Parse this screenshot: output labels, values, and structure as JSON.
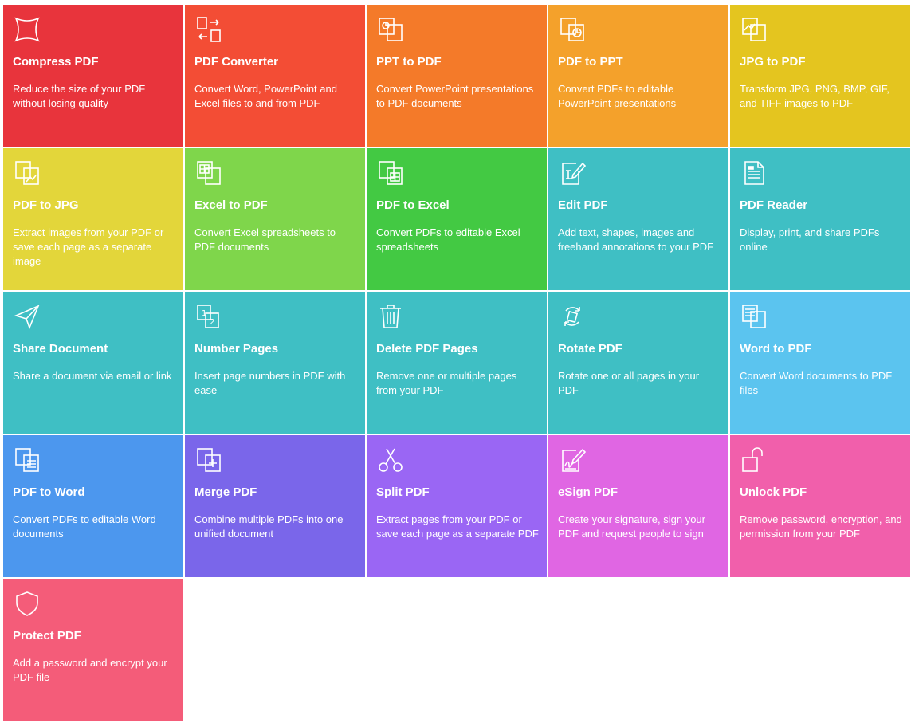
{
  "tools": [
    {
      "title": "Compress PDF",
      "desc": "Reduce the size of your PDF without losing quality",
      "icon": "compress-icon",
      "color": "#e8343c"
    },
    {
      "title": "PDF Converter",
      "desc": "Convert Word, PowerPoint and Excel files to and from PDF",
      "icon": "convert-arrows-icon",
      "color": "#f34d35"
    },
    {
      "title": "PPT to PDF",
      "desc": "Convert PowerPoint presentations to PDF documents",
      "icon": "ppt-document-icon",
      "color": "#f47a29"
    },
    {
      "title": "PDF to PPT",
      "desc": "Convert PDFs to editable PowerPoint presentations",
      "icon": "pdf-to-ppt-icon",
      "color": "#f4a12b"
    },
    {
      "title": "JPG to PDF",
      "desc": "Transform JPG, PNG, BMP, GIF, and TIFF images to PDF",
      "icon": "image-document-icon",
      "color": "#e4c51f"
    },
    {
      "title": "PDF to JPG",
      "desc": "Extract images from your PDF or save each page as a separate image",
      "icon": "pdf-to-image-icon",
      "color": "#e3d63a"
    },
    {
      "title": "Excel to PDF",
      "desc": "Convert Excel spreadsheets to PDF documents",
      "icon": "spreadsheet-document-icon",
      "color": "#7fd64b"
    },
    {
      "title": "PDF to Excel",
      "desc": "Convert PDFs to editable Excel spreadsheets",
      "icon": "pdf-to-spreadsheet-icon",
      "color": "#43c943"
    },
    {
      "title": "Edit PDF",
      "desc": "Add text, shapes, images and freehand annotations to your PDF",
      "icon": "edit-pencil-icon",
      "color": "#3fbfc4"
    },
    {
      "title": "PDF Reader",
      "desc": "Display, print, and share PDFs online",
      "icon": "reader-document-icon",
      "color": "#3fbfc4"
    },
    {
      "title": "Share Document",
      "desc": "Share a document via email or link",
      "icon": "paper-plane-icon",
      "color": "#3fbfc4"
    },
    {
      "title": "Number Pages",
      "desc": "Insert page numbers in PDF with ease",
      "icon": "number-pages-icon",
      "color": "#3fbfc4"
    },
    {
      "title": "Delete PDF Pages",
      "desc": "Remove one or multiple pages from your PDF",
      "icon": "trash-icon",
      "color": "#3fbfc4"
    },
    {
      "title": "Rotate PDF",
      "desc": "Rotate one or all pages in your PDF",
      "icon": "rotate-icon",
      "color": "#3fbfc4"
    },
    {
      "title": "Word to PDF",
      "desc": "Convert Word documents to PDF files",
      "icon": "word-document-icon",
      "color": "#5bc4ef"
    },
    {
      "title": "PDF to Word",
      "desc": "Convert PDFs to editable Word documents",
      "icon": "pdf-to-word-icon",
      "color": "#4c97ee"
    },
    {
      "title": "Merge PDF",
      "desc": "Combine multiple PDFs into one unified document",
      "icon": "merge-plus-icon",
      "color": "#7a66ea"
    },
    {
      "title": "Split PDF",
      "desc": "Extract pages from your PDF or save each page as a separate PDF",
      "icon": "scissors-icon",
      "color": "#9a66f4"
    },
    {
      "title": "eSign PDF",
      "desc": "Create your signature, sign your PDF and request people to sign",
      "icon": "signature-document-icon",
      "color": "#e066e3"
    },
    {
      "title": "Unlock PDF",
      "desc": "Remove password, encryption, and permission from your PDF",
      "icon": "unlock-icon",
      "color": "#f15fab"
    },
    {
      "title": "Protect PDF",
      "desc": "Add a password and encrypt your PDF file",
      "icon": "shield-icon",
      "color": "#f45c79"
    }
  ]
}
